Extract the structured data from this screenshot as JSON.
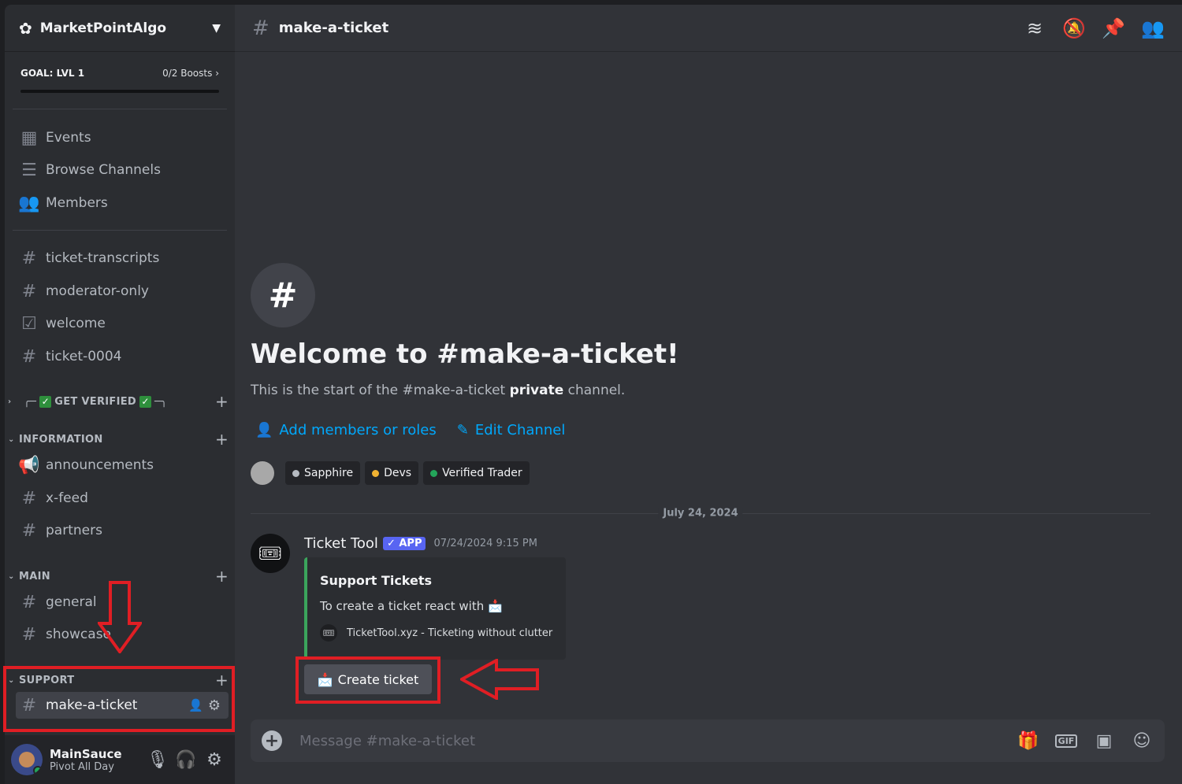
{
  "server": {
    "name": "MarketPointAlgo",
    "boost_goal": "GOAL: LVL 1",
    "boost_count": "0/2 Boosts",
    "boost_progress": 0
  },
  "sidebar": {
    "nav": [
      {
        "label": "Events",
        "icon": "calendar-icon"
      },
      {
        "label": "Browse Channels",
        "icon": "browse-icon"
      },
      {
        "label": "Members",
        "icon": "members-icon"
      }
    ],
    "channels_top": [
      "ticket-transcripts",
      "moderator-only",
      "welcome",
      "ticket-0004"
    ],
    "categories": {
      "get_verified": "GET VERIFIED",
      "information": "INFORMATION",
      "main": "MAIN",
      "support": "SUPPORT"
    },
    "information_channels": [
      "announcements",
      "x-feed",
      "partners"
    ],
    "main_channels": [
      "general",
      "showcase"
    ],
    "support_channels": [
      "make-a-ticket"
    ]
  },
  "user": {
    "name": "MainSauce",
    "status": "Pivot All Day"
  },
  "channel": {
    "name": "make-a-ticket",
    "welcome_title": "Welcome to #make-a-ticket!",
    "welcome_sub_prefix": "This is the start of the #make-a-ticket ",
    "welcome_sub_bold": "private",
    "welcome_sub_suffix": " channel.",
    "add_members": "Add members or roles",
    "edit_channel": "Edit Channel",
    "roles": [
      {
        "name": "Sapphire",
        "color": "#b5bac1"
      },
      {
        "name": "Devs",
        "color": "#f0b232"
      },
      {
        "name": "Verified Trader",
        "color": "#23a55a"
      }
    ],
    "date_divider": "July 24, 2024"
  },
  "message": {
    "author": "Ticket Tool",
    "badge": "APP",
    "timestamp": "07/24/2024 9:15 PM",
    "embed_title": "Support Tickets",
    "embed_desc": "To create a ticket react with",
    "embed_footer": "TicketTool.xyz - Ticketing without clutter",
    "button_label": "Create ticket",
    "embed_color": "#3ba55c"
  },
  "composer": {
    "placeholder": "Message #make-a-ticket"
  },
  "colors": {
    "accent": "#5865f2",
    "link": "#00a8fc",
    "annotation": "#e01e24"
  }
}
